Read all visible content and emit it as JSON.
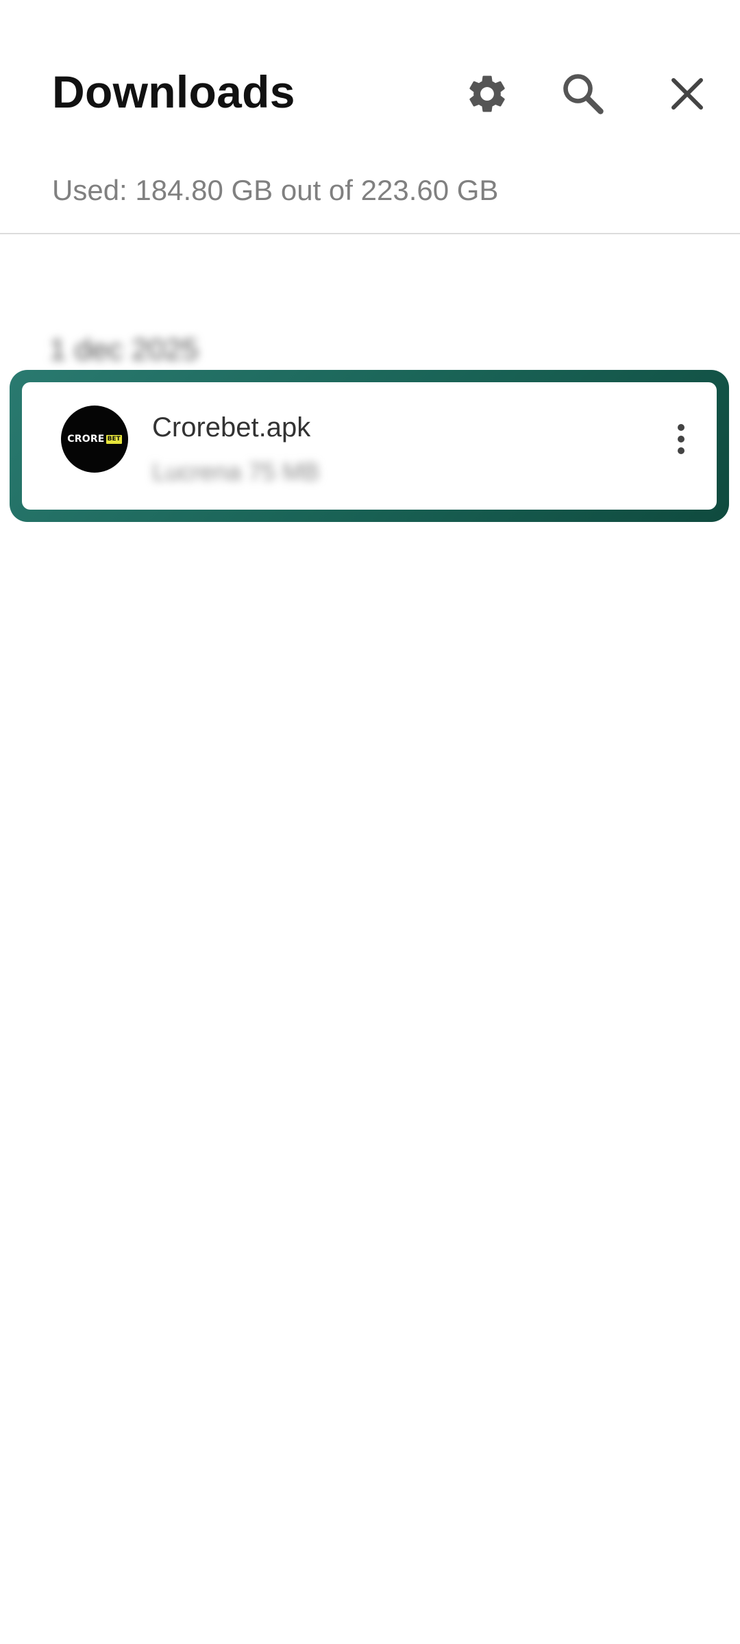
{
  "header": {
    "title": "Downloads",
    "settings_icon": "gear-icon",
    "search_icon": "search-icon",
    "close_icon": "close-icon"
  },
  "storage": {
    "text": "Used: 184.80 GB out of 223.60 GB"
  },
  "downloads": {
    "groups": [
      {
        "date": "1 dec 2025",
        "items": [
          {
            "name": "Crorebet.apk",
            "meta": "Lucrena 75 MB",
            "logo_text": "CRORE",
            "logo_tag": "BET",
            "more_icon": "more-vert-icon"
          }
        ]
      }
    ]
  },
  "colors": {
    "highlight_start": "#2a7a70",
    "highlight_end": "#0f4a3e",
    "logo_accent": "#e6e43a"
  }
}
